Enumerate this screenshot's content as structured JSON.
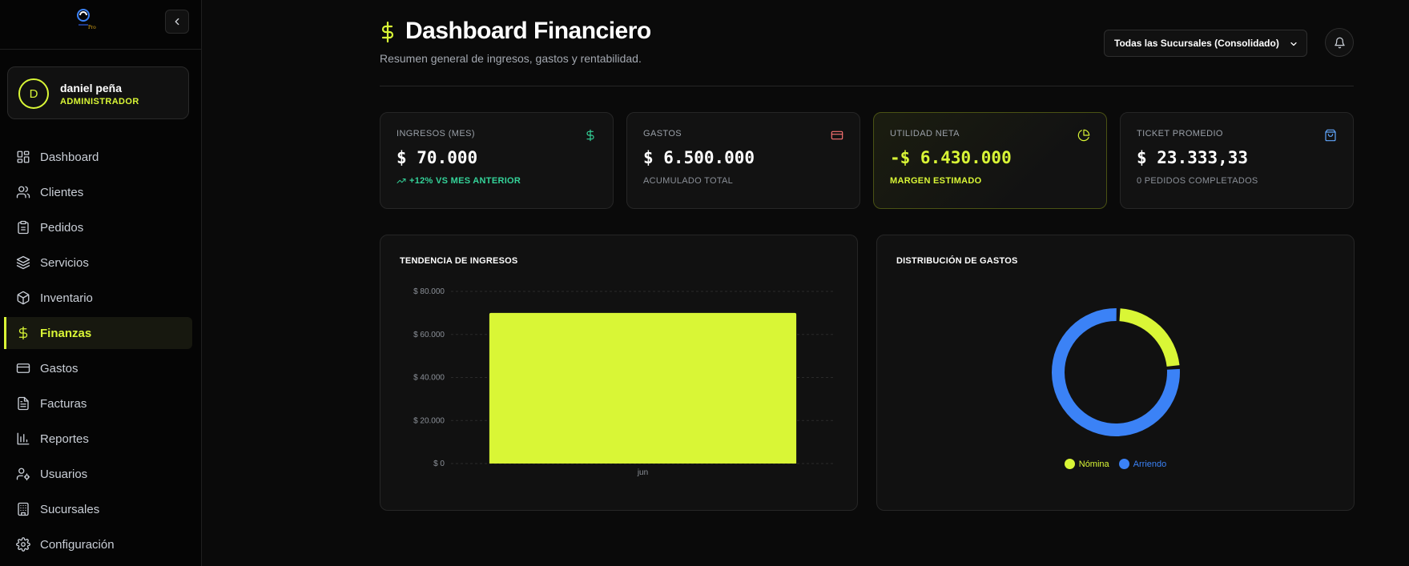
{
  "user": {
    "initial": "D",
    "name": "daniel peña",
    "role": "ADMINISTRADOR"
  },
  "nav": [
    {
      "label": "Dashboard",
      "icon": "grid-icon"
    },
    {
      "label": "Clientes",
      "icon": "users-icon"
    },
    {
      "label": "Pedidos",
      "icon": "clipboard-icon"
    },
    {
      "label": "Servicios",
      "icon": "layers-icon"
    },
    {
      "label": "Inventario",
      "icon": "package-icon"
    },
    {
      "label": "Finanzas",
      "icon": "dollar-icon",
      "active": true
    },
    {
      "label": "Gastos",
      "icon": "credit-card-icon"
    },
    {
      "label": "Facturas",
      "icon": "file-icon"
    },
    {
      "label": "Reportes",
      "icon": "bar-chart-icon"
    },
    {
      "label": "Usuarios",
      "icon": "user-cog-icon"
    },
    {
      "label": "Sucursales",
      "icon": "building-icon"
    },
    {
      "label": "Configuración",
      "icon": "gear-icon"
    }
  ],
  "header": {
    "title": "Dashboard Financiero",
    "subtitle": "Resumen general de ingresos, gastos y rentabilidad.",
    "branch_select": "Todas las Sucursales (Consolidado)"
  },
  "kpis": [
    {
      "label": "INGRESOS (MES)",
      "value": "$ 70.000",
      "foot": "+12% VS MES ANTERIOR",
      "icon": "dollar-icon",
      "icon_color": "#34d399"
    },
    {
      "label": "GASTOS",
      "value": "$ 6.500.000",
      "foot": "ACUMULADO TOTAL",
      "icon": "credit-card-icon",
      "icon_color": "#f87171"
    },
    {
      "label": "UTILIDAD NETA",
      "value": "-$ 6.430.000",
      "foot": "MARGEN ESTIMADO",
      "icon": "pie-chart-icon",
      "icon_color": "#d9f636"
    },
    {
      "label": "TICKET PROMEDIO",
      "value": "$ 23.333,33",
      "foot": "0 PEDIDOS COMPLETADOS",
      "icon": "shopping-bag-icon",
      "icon_color": "#60a5fa"
    }
  ],
  "colors": {
    "accent": "#d9f636",
    "blue": "#3b82f6",
    "green": "#34d399",
    "red": "#f87171"
  },
  "chart_data": [
    {
      "type": "bar",
      "title": "TENDENCIA DE INGRESOS",
      "categories": [
        "jun"
      ],
      "values": [
        70000
      ],
      "ylim": [
        0,
        80000
      ],
      "yticks": [
        0,
        20000,
        40000,
        60000,
        80000
      ],
      "ytick_labels": [
        "$ 0",
        "$ 20.000",
        "$ 40.000",
        "$ 60.000",
        "$ 80.000"
      ],
      "grid": true,
      "color": "#d9f636"
    },
    {
      "type": "pie",
      "title": "DISTRIBUCIÓN DE GASTOS",
      "donut": true,
      "slices": [
        {
          "label": "Nómina",
          "value": 1500000,
          "color": "#d9f636"
        },
        {
          "label": "Arriendo",
          "value": 5000000,
          "color": "#3b82f6"
        }
      ],
      "legend": "bottom"
    }
  ]
}
